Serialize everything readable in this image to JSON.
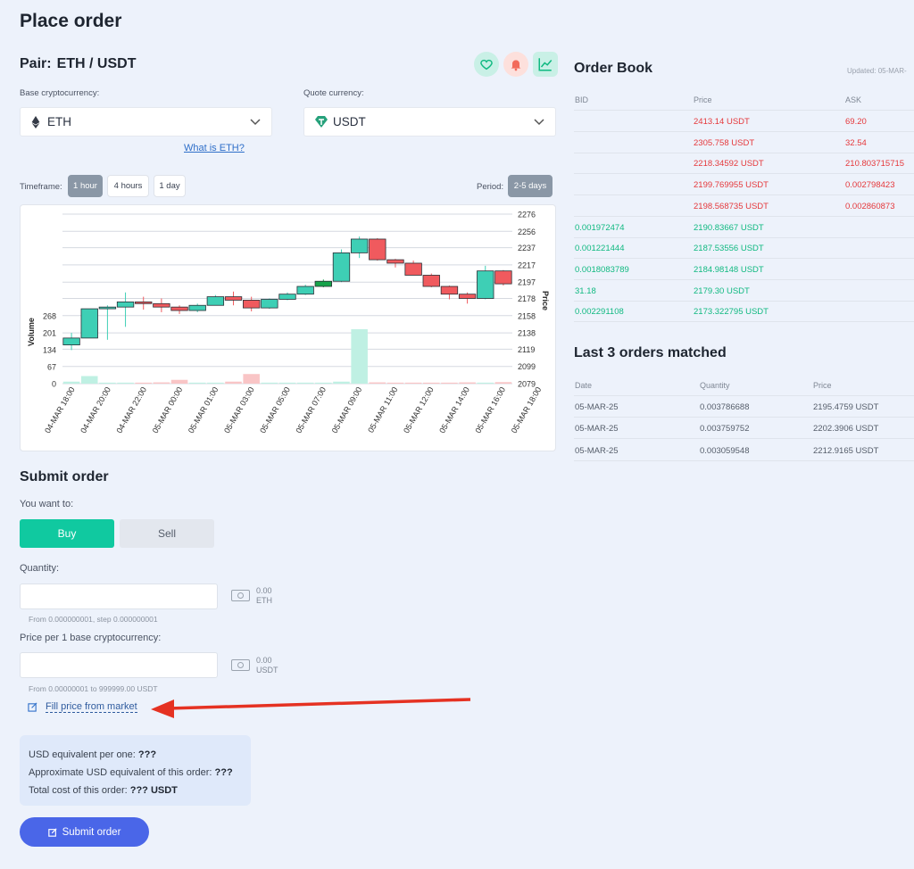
{
  "page": {
    "title": "Place order"
  },
  "pair": {
    "label": "Pair:",
    "value": "ETH / USDT"
  },
  "base": {
    "label": "Base cryptocurrency:",
    "value": "ETH",
    "link": "What is ETH?"
  },
  "quote": {
    "label": "Quote currency:",
    "value": "USDT"
  },
  "timeframe": {
    "label": "Timeframe:",
    "options": [
      "1 hour",
      "4 hours",
      "1 day"
    ],
    "selected": "1 hour"
  },
  "period": {
    "label": "Period:",
    "value": "2-5 days"
  },
  "chart_data": {
    "type": "candlestick",
    "ylabel_right": "Price",
    "ylabel_left": "Volume",
    "price_ticks": [
      2276,
      2256,
      2237,
      2217,
      2197,
      2178,
      2158,
      2138,
      2119,
      2099,
      2079
    ],
    "volume_ticks": [
      268,
      201,
      134,
      67,
      0
    ],
    "x_ticks": [
      "04-MAR 18:00",
      "04-MAR 20:00",
      "04-MAR 22:00",
      "05-MAR 00:00",
      "05-MAR 01:00",
      "05-MAR 03:00",
      "05-MAR 05:00",
      "05-MAR 07:00",
      "05-MAR 09:00",
      "05-MAR 11:00",
      "05-MAR 12:00",
      "05-MAR 14:00",
      "05-MAR 16:00",
      "05-MAR 18:00"
    ],
    "candles": [
      {
        "o": 2124,
        "c": 2132,
        "h": 2138,
        "l": 2118
      },
      {
        "o": 2132,
        "c": 2166,
        "h": 2166,
        "l": 2132
      },
      {
        "o": 2166,
        "c": 2168,
        "h": 2170,
        "l": 2130
      },
      {
        "o": 2168,
        "c": 2174,
        "h": 2185,
        "l": 2145
      },
      {
        "o": 2174,
        "c": 2172,
        "h": 2180,
        "l": 2165
      },
      {
        "o": 2172,
        "c": 2168,
        "h": 2178,
        "l": 2162
      },
      {
        "o": 2168,
        "c": 2164,
        "h": 2170,
        "l": 2160
      },
      {
        "o": 2164,
        "c": 2170,
        "h": 2172,
        "l": 2162
      },
      {
        "o": 2170,
        "c": 2180,
        "h": 2182,
        "l": 2170
      },
      {
        "o": 2180,
        "c": 2176,
        "h": 2186,
        "l": 2170
      },
      {
        "o": 2176,
        "c": 2167,
        "h": 2180,
        "l": 2163
      },
      {
        "o": 2167,
        "c": 2177,
        "h": 2178,
        "l": 2166
      },
      {
        "o": 2177,
        "c": 2183,
        "h": 2185,
        "l": 2176
      },
      {
        "o": 2183,
        "c": 2192,
        "h": 2194,
        "l": 2182
      },
      {
        "o": 2192,
        "c": 2198,
        "h": 2200,
        "l": 2191
      },
      {
        "o": 2198,
        "c": 2231,
        "h": 2235,
        "l": 2197
      },
      {
        "o": 2231,
        "c": 2247,
        "h": 2250,
        "l": 2225
      },
      {
        "o": 2247,
        "c": 2223,
        "h": 2248,
        "l": 2222
      },
      {
        "o": 2223,
        "c": 2219,
        "h": 2224,
        "l": 2214
      },
      {
        "o": 2219,
        "c": 2205,
        "h": 2222,
        "l": 2205
      },
      {
        "o": 2205,
        "c": 2192,
        "h": 2207,
        "l": 2191
      },
      {
        "o": 2192,
        "c": 2183,
        "h": 2193,
        "l": 2177
      },
      {
        "o": 2183,
        "c": 2178,
        "h": 2185,
        "l": 2172
      },
      {
        "o": 2178,
        "c": 2210,
        "h": 2216,
        "l": 2177
      },
      {
        "o": 2210,
        "c": 2195,
        "h": 2211,
        "l": 2193
      }
    ],
    "volumes": [
      8,
      30,
      4,
      4,
      4,
      5,
      15,
      4,
      4,
      8,
      38,
      4,
      4,
      4,
      4,
      8,
      215,
      5,
      4,
      4,
      4,
      4,
      5,
      4,
      6
    ]
  },
  "submit": {
    "title": "Submit order",
    "want_label": "You want to:",
    "buy": "Buy",
    "sell": "Sell",
    "qty_label": "Quantity:",
    "qty_balance": "0.00",
    "qty_unit": "ETH",
    "qty_hint": "From 0.000000001, step 0.000000001",
    "price_label": "Price per 1 base cryptocurrency:",
    "price_balance": "0.00",
    "price_unit": "USDT",
    "price_hint": "From 0.00000001 to 999999.00 USDT",
    "fill_link": "Fill price from market",
    "usd_one_label": "USD equivalent per one:",
    "usd_one_value": "???",
    "usd_order_label": "Approximate USD equivalent of this order:",
    "usd_order_value": "???",
    "total_label": "Total cost of this order:",
    "total_value": "??? USDT",
    "button": "Submit order"
  },
  "order_book": {
    "title": "Order Book",
    "updated": "Updated: 05-MAR-",
    "headers": [
      "BID",
      "Price",
      "ASK"
    ],
    "rows": [
      {
        "bid": "",
        "price": "2413.14 USDT",
        "ask": "69.20",
        "side": "ask"
      },
      {
        "bid": "",
        "price": "2305.758 USDT",
        "ask": "32.54",
        "side": "ask"
      },
      {
        "bid": "",
        "price": "2218.34592 USDT",
        "ask": "210.803715715",
        "side": "ask"
      },
      {
        "bid": "",
        "price": "2199.769955 USDT",
        "ask": "0.002798423",
        "side": "ask"
      },
      {
        "bid": "",
        "price": "2198.568735 USDT",
        "ask": "0.002860873",
        "side": "ask"
      },
      {
        "bid": "0.001972474",
        "price": "2190.83667 USDT",
        "ask": "",
        "side": "bid"
      },
      {
        "bid": "0.001221444",
        "price": "2187.53556 USDT",
        "ask": "",
        "side": "bid"
      },
      {
        "bid": "0.0018083789",
        "price": "2184.98148 USDT",
        "ask": "",
        "side": "bid"
      },
      {
        "bid": "31.18",
        "price": "2179.30 USDT",
        "ask": "",
        "side": "bid"
      },
      {
        "bid": "0.002291108",
        "price": "2173.322795 USDT",
        "ask": "",
        "side": "bid"
      }
    ]
  },
  "last_orders": {
    "title": "Last 3 orders matched",
    "headers": [
      "Date",
      "Quantity",
      "Price"
    ],
    "rows": [
      {
        "date": "05-MAR-25",
        "qty": "0.003786688",
        "price": "2195.4759 USDT"
      },
      {
        "date": "05-MAR-25",
        "qty": "0.003759752",
        "price": "2202.3906 USDT"
      },
      {
        "date": "05-MAR-25",
        "qty": "0.003059548",
        "price": "2212.9165 USDT"
      }
    ]
  },
  "colors": {
    "up": "#3ecfb5",
    "down": "#f05a5e",
    "up_strong": "#16a34a",
    "accent": "#00c9a0",
    "primary": "#4a66e8",
    "arrow": "#e53222"
  }
}
